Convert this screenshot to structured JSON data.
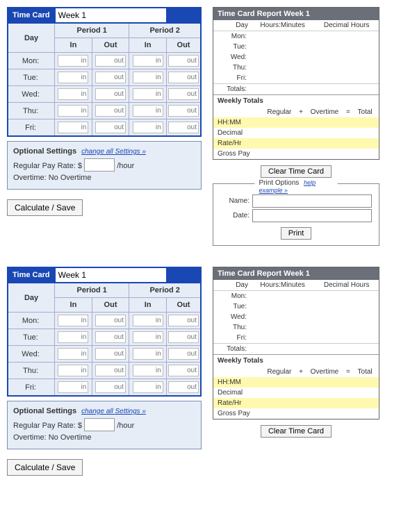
{
  "card_title": "Time Card",
  "week_value": "Week 1",
  "day_header": "Day",
  "period1_header": "Period 1",
  "period2_header": "Period 2",
  "in_header": "In",
  "out_header": "Out",
  "days": [
    "Mon:",
    "Tue:",
    "Wed:",
    "Thu:",
    "Fri:"
  ],
  "ph_in": "in",
  "ph_out": "out",
  "opt": {
    "title": "Optional Settings",
    "link": "change all Settings »",
    "pay_label_pre": "Regular Pay Rate: $",
    "pay_label_post": "/hour",
    "overtime": "Overtime: No Overtime"
  },
  "calc_btn": "Calculate / Save",
  "rpt": {
    "title": "Time Card Report Week 1",
    "col_day": "Day",
    "col_hm": "Hours:Minutes",
    "col_dh": "Decimal Hours",
    "days": [
      "Mon:",
      "Tue:",
      "Wed:",
      "Thu:",
      "Fri:"
    ],
    "totals_lbl": "Totals:",
    "wk_hdr": "Weekly Totals",
    "sub_reg": "Regular",
    "sub_plus": "+",
    "sub_ot": "Overtime",
    "sub_eq": "=",
    "sub_tot": "Total",
    "rows": [
      "HH:MM",
      "Decimal",
      "Rate/Hr",
      "Gross Pay"
    ],
    "clear_btn": "Clear Time Card"
  },
  "print": {
    "legend": "Print Options",
    "legend_link": "help example »",
    "name_lbl": "Name:",
    "date_lbl": "Date:",
    "btn": "Print"
  }
}
